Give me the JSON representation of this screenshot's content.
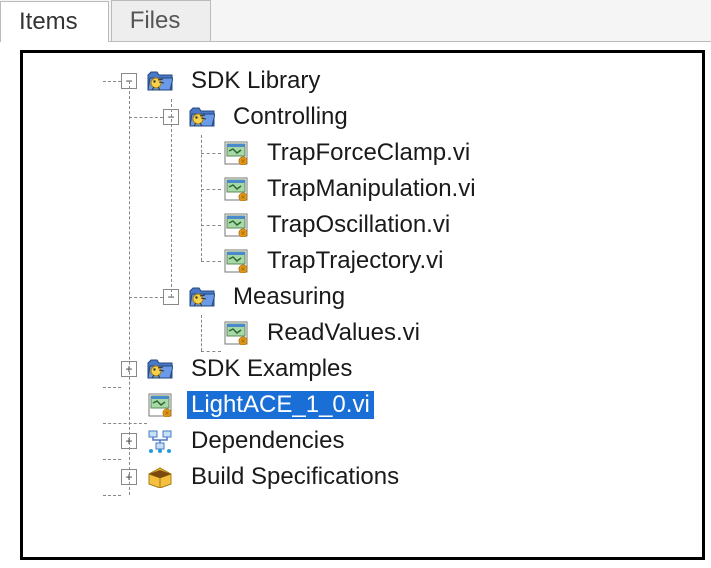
{
  "tabs": {
    "items": "Items",
    "files": "Files",
    "active": "items"
  },
  "tree": {
    "sdkLibrary": {
      "label": "SDK Library",
      "expanded": true
    },
    "controlling": {
      "label": "Controlling",
      "expanded": true
    },
    "ctrlItems": {
      "0": "TrapForceClamp.vi",
      "1": "TrapManipulation.vi",
      "2": "TrapOscillation.vi",
      "3": "TrapTrajectory.vi"
    },
    "measuring": {
      "label": "Measuring",
      "expanded": true
    },
    "measItems": {
      "0": "ReadValues.vi"
    },
    "sdkExamples": {
      "label": "SDK Examples",
      "expanded": false
    },
    "lightace": {
      "label": "LightACE_1_0.vi",
      "selected": true
    },
    "dependencies": {
      "label": "Dependencies",
      "expanded": false
    },
    "buildSpecs": {
      "label": "Build Specifications",
      "expanded": false
    }
  },
  "toggles": {
    "minus": "−",
    "plus": "+"
  }
}
